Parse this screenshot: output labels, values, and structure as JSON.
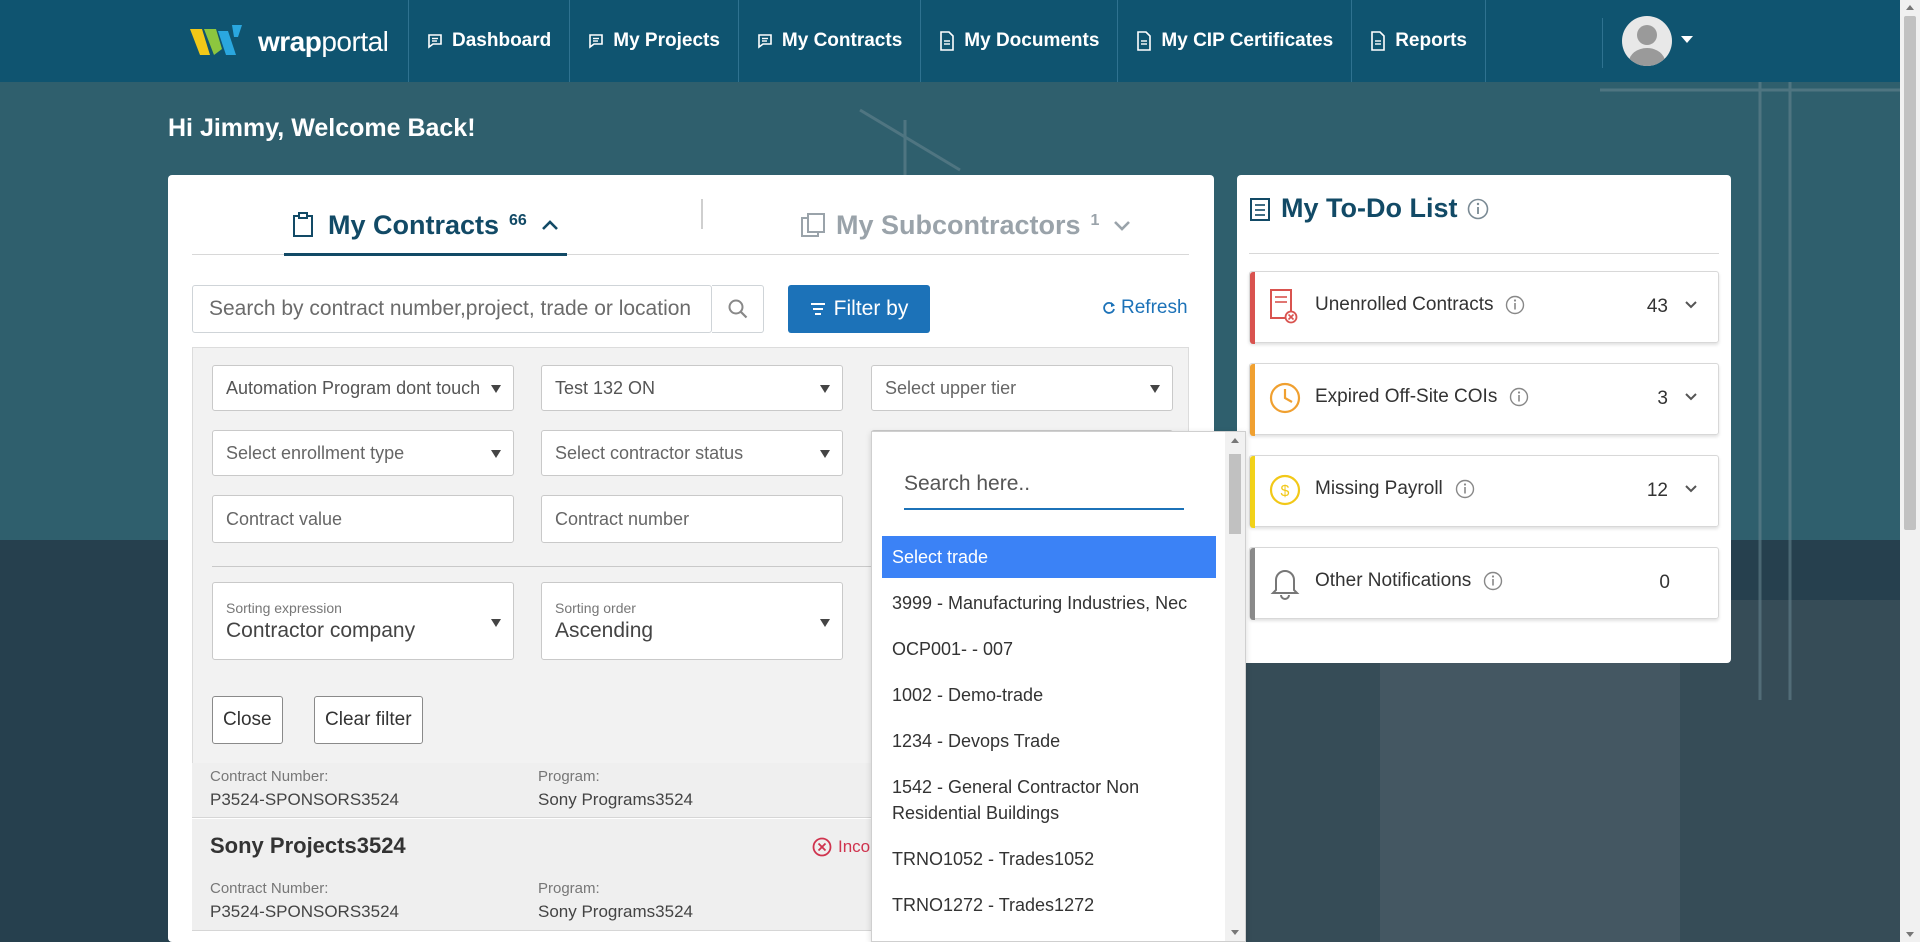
{
  "brand": {
    "logo_text_bold": "wrap",
    "logo_text_light": "portal"
  },
  "nav": {
    "items": [
      {
        "label": "Dashboard",
        "icon": "chat-icon"
      },
      {
        "label": "My Projects",
        "icon": "chat-icon"
      },
      {
        "label": "My Contracts",
        "icon": "chat-icon"
      },
      {
        "label": "My Documents",
        "icon": "document-icon"
      },
      {
        "label": "My CIP Certificates",
        "icon": "document-icon"
      },
      {
        "label": "Reports",
        "icon": "document-icon"
      }
    ]
  },
  "welcome": "Hi Jimmy, Welcome Back!",
  "tabs": {
    "contracts": {
      "label": "My Contracts",
      "count": "66"
    },
    "subcontractors": {
      "label": "My Subcontractors",
      "count": "1"
    }
  },
  "search": {
    "placeholder": "Search by contract number,project, trade or location"
  },
  "filter_button": "Filter by",
  "refresh": "Refresh",
  "filters": {
    "program": "Automation Program dont touch",
    "project": "Test 132 ON",
    "upper_tier": "Select upper tier",
    "enrollment_type": "Select enrollment type",
    "contractor_status": "Select contractor status",
    "contract_value": "Contract value",
    "contract_number": "Contract number",
    "sorting_expression_label": "Sorting expression",
    "sorting_expression_value": "Contractor company",
    "sorting_order_label": "Sorting order",
    "sorting_order_value": "Ascending",
    "close": "Close",
    "clear": "Clear filter"
  },
  "contracts": [
    {
      "name": "",
      "contract_number_label": "Contract Number:",
      "contract_number": "P3524-SPONSORS3524",
      "program_label": "Program:",
      "program": "Sony Programs3524",
      "status": ""
    },
    {
      "name": "Sony Projects3524",
      "contract_number_label": "Contract Number:",
      "contract_number": "P3524-SPONSORS3524",
      "program_label": "Program:",
      "program": "Sony Programs3524",
      "status": "Incom"
    }
  ],
  "trade_dropdown": {
    "search_placeholder": "Search here..",
    "options": [
      "Select trade",
      "3999 - Manufacturing Industries, Nec",
      "OCP001- - 007",
      "1002 - Demo-trade",
      "1234 - Devops Trade",
      "1542 - General Contractor Non Residential Buildings",
      "TRNO1052 - Trades1052",
      "TRNO1272 - Trades1272"
    ],
    "selected_index": 0
  },
  "todo": {
    "title": "My To-Do List",
    "items": [
      {
        "label": "Unenrolled Contracts",
        "count": "43",
        "color": "#d9534f",
        "icon": "contract-x-icon"
      },
      {
        "label": "Expired Off-Site COIs",
        "count": "3",
        "color": "#f0a030",
        "icon": "clock-icon"
      },
      {
        "label": "Missing Payroll",
        "count": "12",
        "color": "#f2d21a",
        "icon": "dollar-icon"
      },
      {
        "label": "Other Notifications",
        "count": "0",
        "color": "#8a8a8a",
        "icon": "bell-icon"
      }
    ]
  },
  "colors": {
    "nav_bg": "#0f5470",
    "primary": "#1c72b8",
    "heading": "#124a66"
  }
}
